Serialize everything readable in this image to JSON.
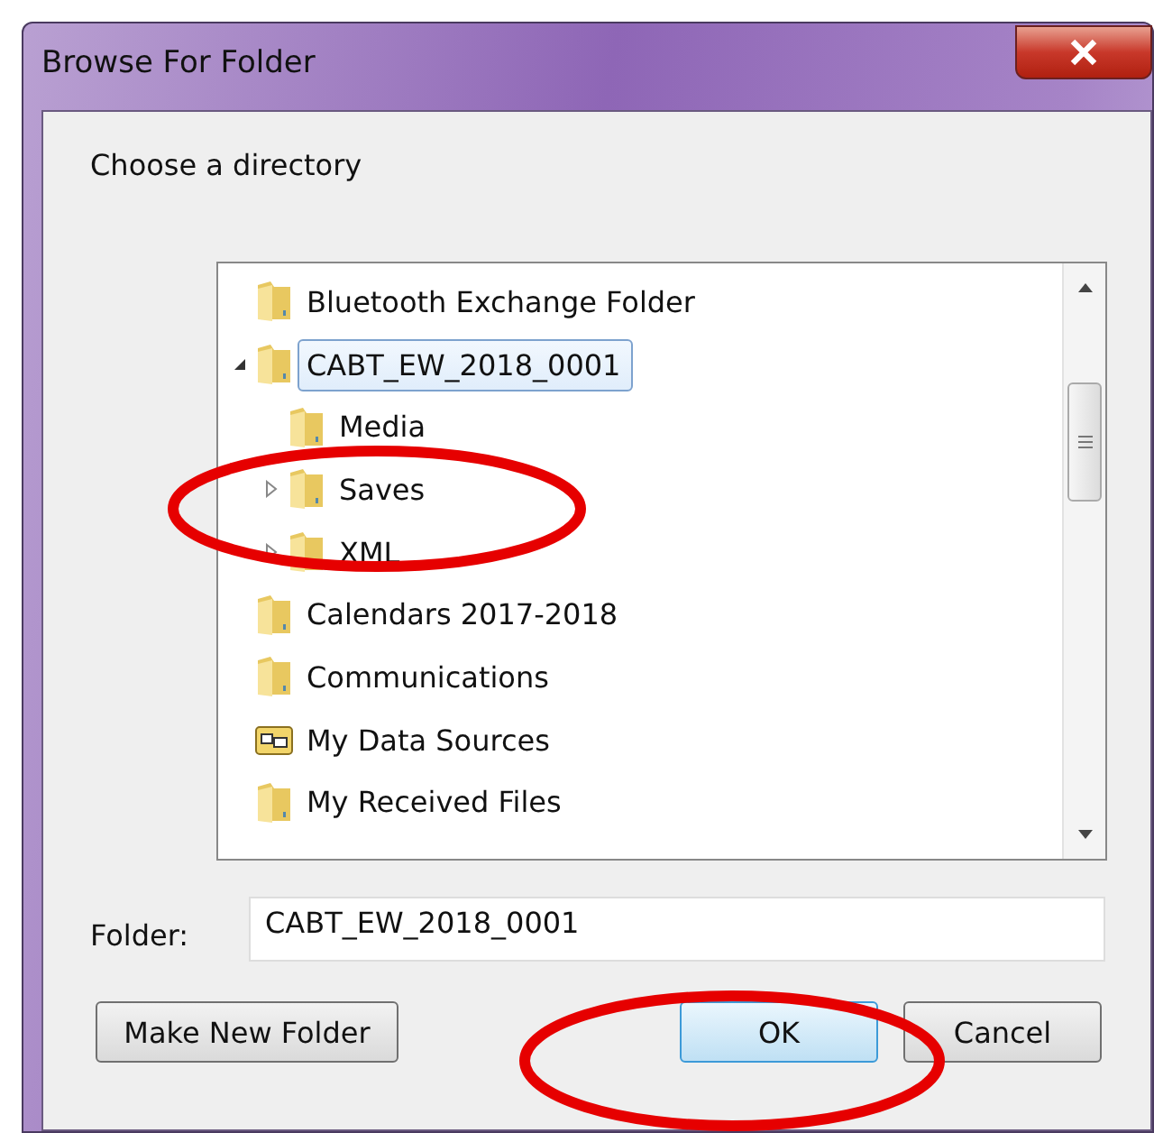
{
  "window": {
    "title": "Browse For Folder"
  },
  "prompt": "Choose a directory",
  "tree": [
    {
      "label": "Bluetooth Exchange Folder",
      "kind": "folder",
      "selected": false
    },
    {
      "label": "CABT_EW_2018_0001",
      "kind": "folder",
      "selected": true,
      "expanded": true,
      "children": [
        {
          "label": "Media",
          "kind": "folder",
          "selected": false
        },
        {
          "label": "Saves",
          "kind": "folder",
          "selected": false,
          "expanded": false
        },
        {
          "label": "XML",
          "kind": "folder",
          "selected": false,
          "expanded": false
        }
      ]
    },
    {
      "label": "Calendars 2017-2018",
      "kind": "folder",
      "selected": false
    },
    {
      "label": "Communications",
      "kind": "folder",
      "selected": false
    },
    {
      "label": "My Data Sources",
      "kind": "data-source",
      "selected": false
    },
    {
      "label": "My Received Files",
      "kind": "folder",
      "selected": false
    }
  ],
  "folder_field": {
    "label": "Folder:",
    "value": "CABT_EW_2018_0001"
  },
  "buttons": [
    {
      "label": "Make New Folder",
      "default": false
    },
    {
      "label": "OK",
      "default": true
    },
    {
      "label": "Cancel",
      "default": false
    }
  ]
}
